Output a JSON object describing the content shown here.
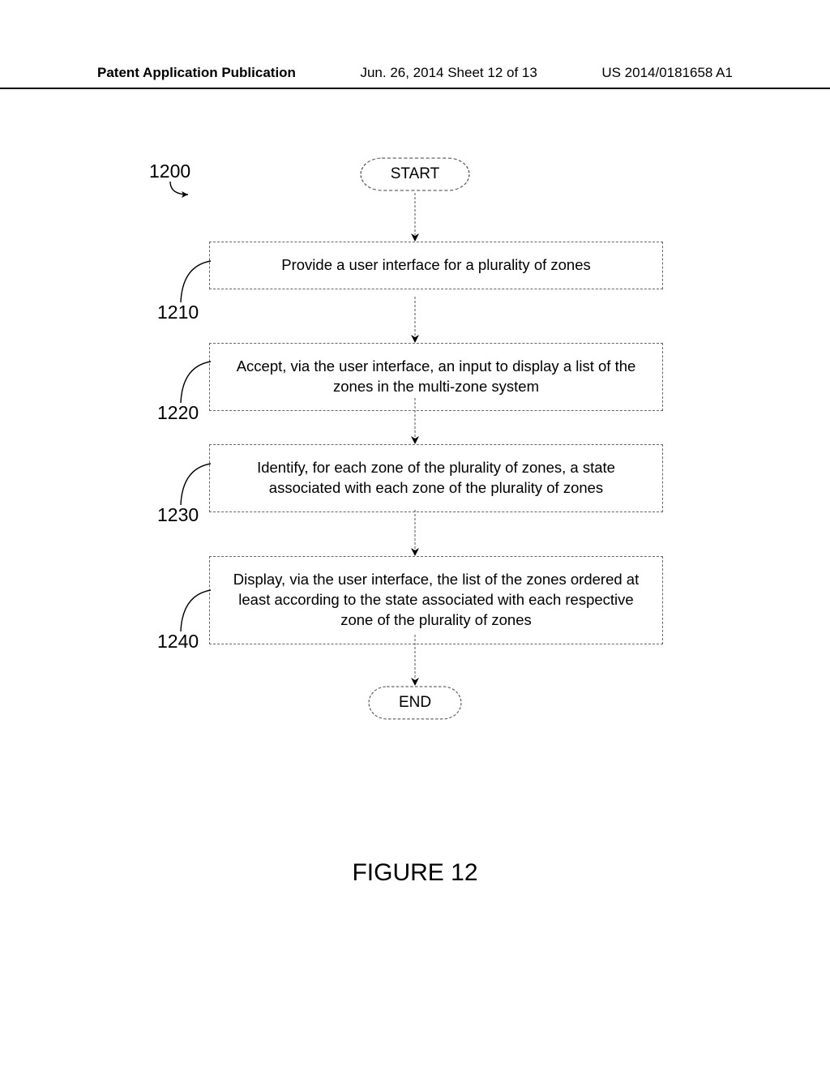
{
  "header": {
    "publication_type": "Patent Application Publication",
    "date_sheet": "Jun. 26, 2014  Sheet 12 of 13",
    "pub_number": "US 2014/0181658 A1"
  },
  "diagram": {
    "figure_number": "1200",
    "start_label": "START",
    "end_label": "END",
    "steps": [
      {
        "ref": "1210",
        "text": "Provide a user interface for a plurality of zones"
      },
      {
        "ref": "1220",
        "text": "Accept, via the user interface, an input to display a list of the zones in the multi-zone system"
      },
      {
        "ref": "1230",
        "text": "Identify, for each zone of the plurality of zones, a state associated with each zone of the plurality of zones"
      },
      {
        "ref": "1240",
        "text": "Display, via the user interface, the list of the zones ordered at least according to the state associated with each respective zone of the plurality of zones"
      }
    ]
  },
  "figure_caption": "FIGURE 12",
  "chart_data": {
    "type": "flowchart",
    "title": "FIGURE 12",
    "figure_ref": "1200",
    "nodes": [
      {
        "id": "start",
        "type": "terminal",
        "label": "START"
      },
      {
        "id": "1210",
        "type": "process",
        "label": "Provide a user interface for a plurality of zones"
      },
      {
        "id": "1220",
        "type": "process",
        "label": "Accept, via the user interface, an input to display a list of the zones in the multi-zone system"
      },
      {
        "id": "1230",
        "type": "process",
        "label": "Identify, for each zone of the plurality of zones, a state associated with each zone of the plurality of zones"
      },
      {
        "id": "1240",
        "type": "process",
        "label": "Display, via the user interface, the list of the zones ordered at least according to the state associated with each respective zone of the plurality of zones"
      },
      {
        "id": "end",
        "type": "terminal",
        "label": "END"
      }
    ],
    "edges": [
      {
        "from": "start",
        "to": "1210"
      },
      {
        "from": "1210",
        "to": "1220"
      },
      {
        "from": "1220",
        "to": "1230"
      },
      {
        "from": "1230",
        "to": "1240"
      },
      {
        "from": "1240",
        "to": "end"
      }
    ]
  }
}
